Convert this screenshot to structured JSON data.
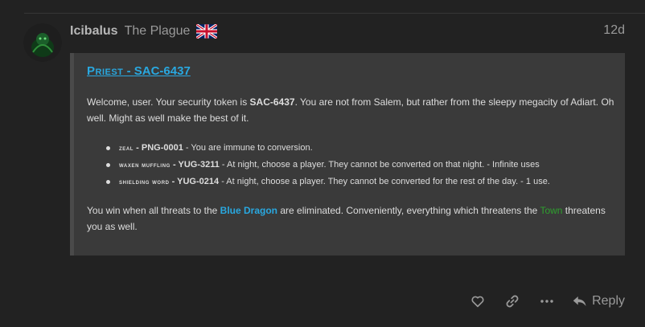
{
  "post": {
    "username": "Icibalus",
    "user_title": "The Plague",
    "date": "12d"
  },
  "quote": {
    "role_prefix": "Priest",
    "role_separator": " - ",
    "role_token": "SAC-6437",
    "intro_1": "Welcome, user. Your security token is ",
    "intro_token": "SAC-6437",
    "intro_2": ". You are not from Salem, but rather from the sleepy megacity of Adiart. Oh well. Might as well make the best of it.",
    "abilities": [
      {
        "name": "Zeal",
        "code": "PNG-0001",
        "text": " - You are immune to conversion."
      },
      {
        "name": "Waxen Muffling",
        "code": "YUG-3211",
        "text": " - At night, choose a player. They cannot be converted on that night. - Infinite uses"
      },
      {
        "name": "Shielding Word",
        "code": "YUG-0214",
        "text": " - At night, choose a player. They cannot be converted for the rest of the day. - 1 use."
      }
    ],
    "ability_separator": " - ",
    "win_1": "You win when all threats to the ",
    "win_faction": "Blue Dragon",
    "win_2": " are eliminated. Conveniently, everything which threatens the ",
    "win_town": "Town",
    "win_3": " threatens you as well."
  },
  "actions": {
    "like_icon": "heart-icon",
    "link_icon": "link-icon",
    "more_icon": "ellipsis-icon",
    "reply_label": "Reply"
  },
  "colors": {
    "accent_blue": "#29a8e0",
    "town_green": "#2ea02e",
    "background": "#222222",
    "quote_background": "#3a3a3a"
  }
}
